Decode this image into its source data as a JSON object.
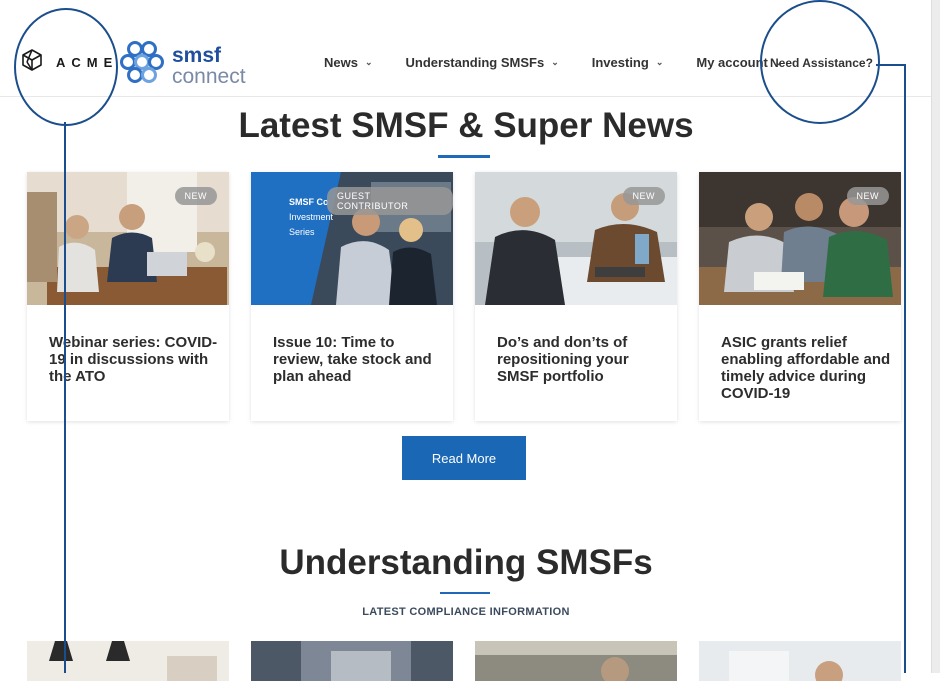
{
  "brand": {
    "acme_text": "ACME",
    "smsf_word1": "smsf",
    "smsf_word2": "connect"
  },
  "nav": {
    "items": [
      {
        "label": "News"
      },
      {
        "label": "Understanding SMSFs"
      },
      {
        "label": "Investing"
      },
      {
        "label": "My account"
      }
    ],
    "need_assistance": "Need Assistance?"
  },
  "news_section": {
    "title": "Latest SMSF & Super News",
    "cards": [
      {
        "badge": "NEW",
        "title": "Webinar series: COVID-19 in discussions with the ATO"
      },
      {
        "badge": "GUEST CONTRIBUTOR",
        "image_text": [
          "SMSF Co",
          "Investment",
          "Series"
        ],
        "title": "Issue 10: Time to review, take stock and plan ahead"
      },
      {
        "badge": "NEW",
        "title": "Do’s and don’ts of repositioning your SMSF portfolio"
      },
      {
        "badge": "NEW",
        "title": "ASIC grants relief enabling affordable and timely advice during COVID-19"
      }
    ],
    "read_more_label": "Read More"
  },
  "understanding_section": {
    "title": "Understanding SMSFs",
    "subtitle": "LATEST COMPLIANCE INFORMATION"
  },
  "colors": {
    "accent": "#1a68b5",
    "annotation": "#1b4e8c",
    "badge": "#969696"
  }
}
